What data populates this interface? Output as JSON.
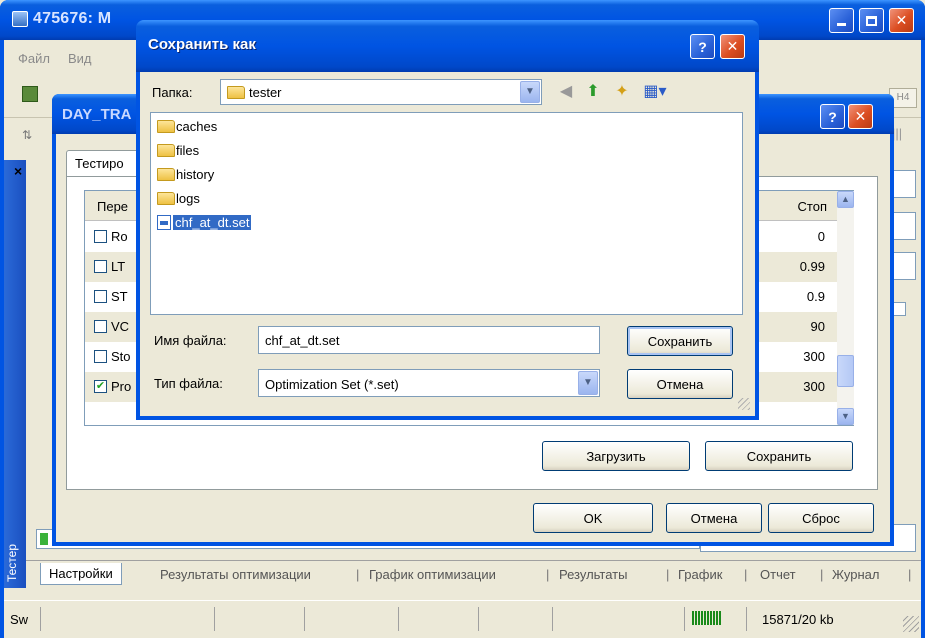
{
  "main_window": {
    "title": "475676: M",
    "menu": [
      "Файл",
      "Вид"
    ],
    "toolbar_right_label": "H4"
  },
  "tester_panel": {
    "vertical_label": "Тестер",
    "bottom_tabs": [
      "Настройки",
      "Результаты оптимизации",
      "График оптимизации",
      "Результаты",
      "График",
      "Отчет",
      "Журнал"
    ]
  },
  "status_bar": {
    "left_text": "Sw",
    "traffic": "15871/20 kb"
  },
  "day_dialog": {
    "title": "DAY_TRA",
    "tab_label": "Тестиро",
    "grid": {
      "header_name": "Пере",
      "header_stop": "Стоп",
      "rows": [
        {
          "name": "Ro",
          "checked": false,
          "stop": "0"
        },
        {
          "name": "LT",
          "checked": false,
          "stop": "0.99"
        },
        {
          "name": "ST",
          "checked": false,
          "stop": "0.9"
        },
        {
          "name": "VC",
          "checked": false,
          "stop": "90"
        },
        {
          "name": "Sto",
          "checked": false,
          "stop": "300"
        },
        {
          "name": "Pro",
          "checked": true,
          "stop": "300"
        }
      ]
    },
    "buttons": {
      "load": "Загрузить",
      "save": "Сохранить",
      "ok": "OK",
      "cancel": "Отмена",
      "reset": "Сброс"
    }
  },
  "save_dialog": {
    "title": "Сохранить как",
    "folder_label": "Папка:",
    "folder_value": "tester",
    "files": [
      {
        "name": "caches",
        "type": "folder"
      },
      {
        "name": "files",
        "type": "folder"
      },
      {
        "name": "history",
        "type": "folder"
      },
      {
        "name": "logs",
        "type": "folder"
      },
      {
        "name": "chf_at_dt.set",
        "type": "file",
        "selected": true
      }
    ],
    "filename_label": "Имя файла:",
    "filename_value": "chf_at_dt.set",
    "filetype_label": "Тип файла:",
    "filetype_value": "Optimization Set (*.set)",
    "save_button": "Сохранить",
    "cancel_button": "Отмена"
  },
  "colors": {
    "xp_blue": "#0054e3",
    "selection": "#316ac5",
    "face": "#ece9d8"
  }
}
